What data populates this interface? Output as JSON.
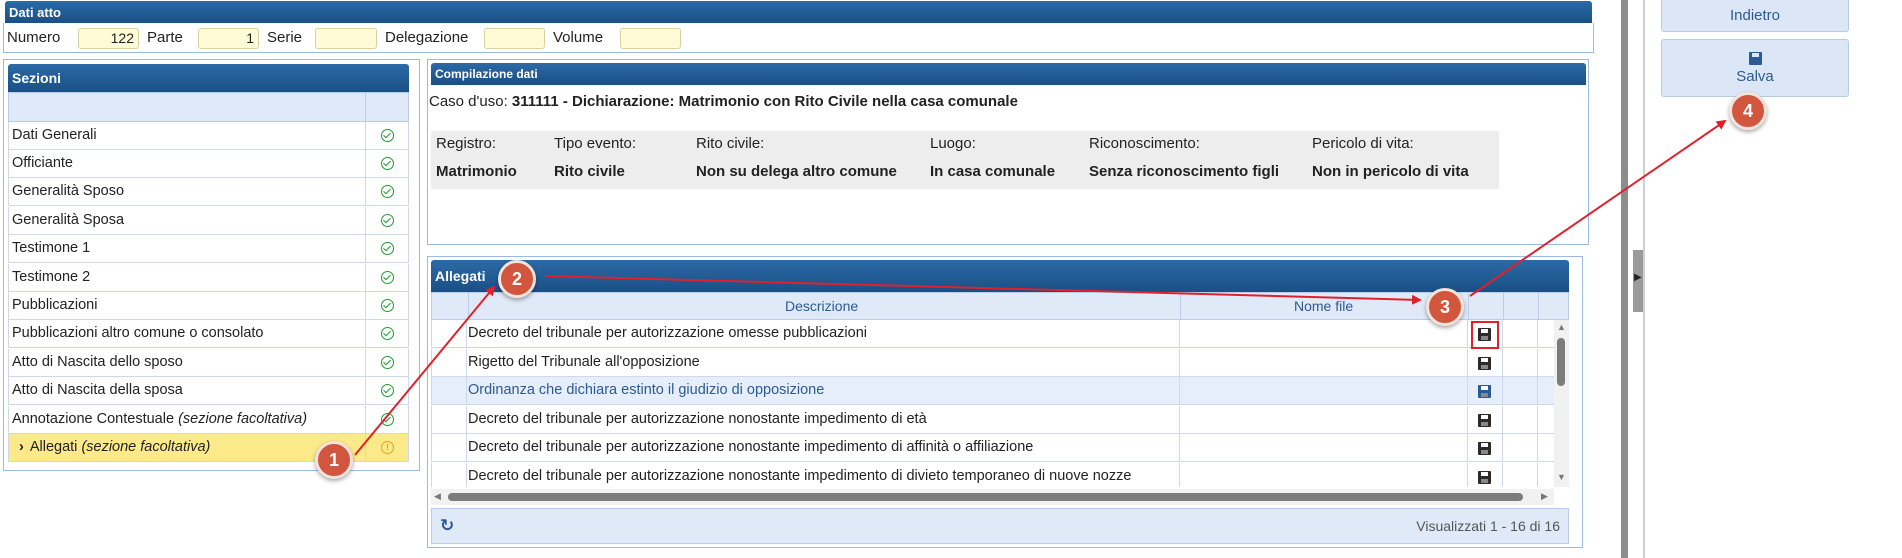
{
  "dati_atto": {
    "title": "Dati atto",
    "fields": [
      {
        "label": "Numero",
        "value": "122"
      },
      {
        "label": "Parte",
        "value": "1"
      },
      {
        "label": "Serie",
        "value": ""
      },
      {
        "label": "Delegazione",
        "value": ""
      },
      {
        "label": "Volume",
        "value": ""
      }
    ]
  },
  "sezioni": {
    "title": "Sezioni",
    "items": [
      {
        "label": "Dati Generali",
        "status": "ok"
      },
      {
        "label": "Officiante",
        "status": "ok"
      },
      {
        "label": "Generalità Sposo",
        "status": "ok"
      },
      {
        "label": "Generalità Sposa",
        "status": "ok"
      },
      {
        "label": "Testimone 1",
        "status": "ok"
      },
      {
        "label": "Testimone 2",
        "status": "ok"
      },
      {
        "label": "Pubblicazioni",
        "status": "ok"
      },
      {
        "label": "Pubblicazioni altro comune o consolato",
        "status": "ok"
      },
      {
        "label": "Atto di Nascita dello sposo",
        "status": "ok"
      },
      {
        "label": "Atto di Nascita della sposa",
        "status": "ok"
      },
      {
        "label": "Annotazione Contestuale",
        "label_italic": "(sezione facoltativa)",
        "status": "ok"
      },
      {
        "label": "Allegati",
        "label_italic": "(sezione facoltativa)",
        "status": "warning",
        "selected": true,
        "expander": "›"
      }
    ]
  },
  "compilazione": {
    "title": "Compilazione dati",
    "caso_uso_label": "Caso d'uso:",
    "caso_uso_value": "311111 - Dichiarazione: Matrimonio con Rito Civile nella casa comunale",
    "columns": [
      {
        "header": "Registro:",
        "value": "Matrimonio"
      },
      {
        "header": "Tipo evento:",
        "value": "Rito civile"
      },
      {
        "header": "Rito civile:",
        "value": "Non su delega altro comune"
      },
      {
        "header": "Luogo:",
        "value": "In casa comunale"
      },
      {
        "header": "Riconoscimento:",
        "value": "Senza riconoscimento figli"
      },
      {
        "header": "Pericolo di vita:",
        "value": "Non in pericolo di vita"
      }
    ]
  },
  "allegati": {
    "title": "Allegati",
    "col_descrizione": "Descrizione",
    "col_nome_file": "Nome file",
    "rows": [
      {
        "descrizione": "Decreto del tribunale per autorizzazione omesse pubblicazioni",
        "nome_file": ""
      },
      {
        "descrizione": "Rigetto del Tribunale all'opposizione",
        "nome_file": ""
      },
      {
        "descrizione": "Ordinanza che dichiara estinto il giudizio di opposizione",
        "nome_file": "",
        "highlighted": true
      },
      {
        "descrizione": "Decreto del tribunale per autorizzazione nonostante impedimento di età",
        "nome_file": ""
      },
      {
        "descrizione": "Decreto del tribunale per autorizzazione nonostante impedimento di affinità o affiliazione",
        "nome_file": ""
      },
      {
        "descrizione": "Decreto del tribunale per autorizzazione nonostante impedimento di divieto temporaneo di nuove nozze",
        "nome_file": ""
      }
    ],
    "footer_text": "Visualizzati 1 - 16 di 16",
    "refresh_icon": "↻"
  },
  "actions": {
    "indietro": "Indietro",
    "salva": "Salva",
    "salva_icon": "floppy-disk"
  },
  "annotations": {
    "step1": "1",
    "step2": "2",
    "step3": "3",
    "step4": "4",
    "color": "#e0212b"
  }
}
